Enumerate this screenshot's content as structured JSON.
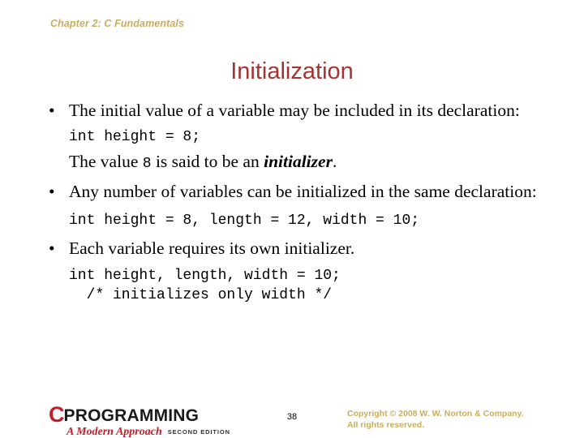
{
  "slide": {
    "chapter_header": "Chapter 2: C Fundamentals",
    "title": "Initialization",
    "colors": {
      "header_tan": "#C8AD5F",
      "title_red": "#A33330",
      "logo_red": "#C0202A",
      "body_black": "#000000",
      "background": "#FFFFFF"
    }
  },
  "content": {
    "bullet_1": "The initial value of a variable may be included in its declaration:",
    "code_1": "int height = 8;",
    "value_sentence": {
      "prefix": "The value ",
      "literal": "8",
      "middle": " is said to be an ",
      "term": "initializer",
      "suffix": "."
    },
    "bullet_2": "Any number of variables can be initialized in the same declaration:",
    "code_2": "int height = 8, length = 12, width = 10;",
    "bullet_3": "Each variable requires its own initializer.",
    "code_3_line_1": "int height, length, width = 10;",
    "code_3_line_2": "  /* initializes only width */",
    "bullet_marker": "•"
  },
  "footer": {
    "logo": {
      "initial": "C",
      "wordmark": "PROGRAMMING",
      "tagline": "A Modern Approach",
      "edition": "SECOND EDITION"
    },
    "page_number": "38",
    "copyright_line_1": "Copyright © 2008 W. W. Norton & Company.",
    "copyright_line_2": "All rights reserved."
  }
}
